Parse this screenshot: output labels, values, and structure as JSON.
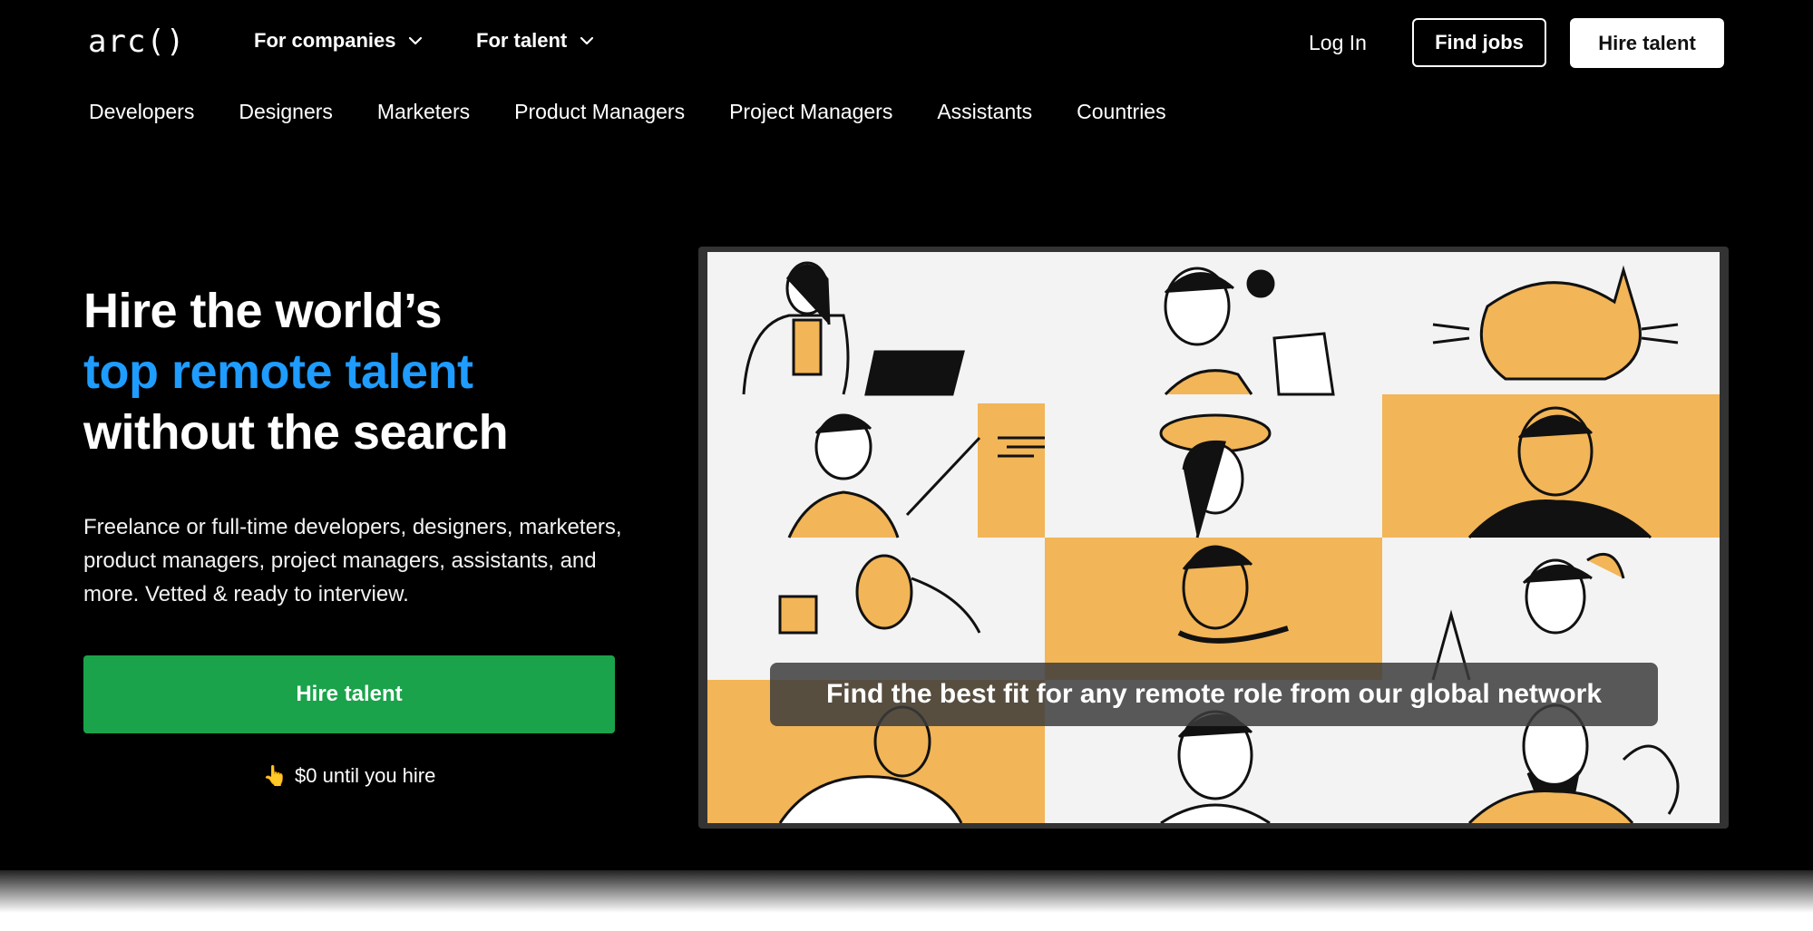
{
  "header": {
    "logo": "arc()",
    "nav": [
      {
        "label": "For companies",
        "icon": "chevron-down-icon"
      },
      {
        "label": "For talent",
        "icon": "chevron-down-icon"
      }
    ],
    "login_label": "Log In",
    "find_jobs_label": "Find jobs",
    "hire_talent_label": "Hire talent"
  },
  "subnav": [
    {
      "label": "Developers"
    },
    {
      "label": "Designers"
    },
    {
      "label": "Marketers"
    },
    {
      "label": "Product Managers"
    },
    {
      "label": "Project Managers"
    },
    {
      "label": "Assistants"
    },
    {
      "label": "Countries"
    }
  ],
  "hero": {
    "title_line1": "Hire the world’s",
    "title_line2": "top remote talent",
    "title_line3": "without the search",
    "description": "Freelance or full-time developers, designers, marketers, product managers, project managers, assistants, and more. Vetted & ready to interview.",
    "cta_label": "Hire talent",
    "note_emoji": "👆",
    "note_text": "$0 until you hire"
  },
  "video": {
    "caption": "Find the best fit for any remote role from our global network"
  },
  "colors": {
    "background": "#000000",
    "accent_blue": "#1e9cff",
    "cta_green": "#1aa34a",
    "illustration_yellow": "#f2b557"
  }
}
